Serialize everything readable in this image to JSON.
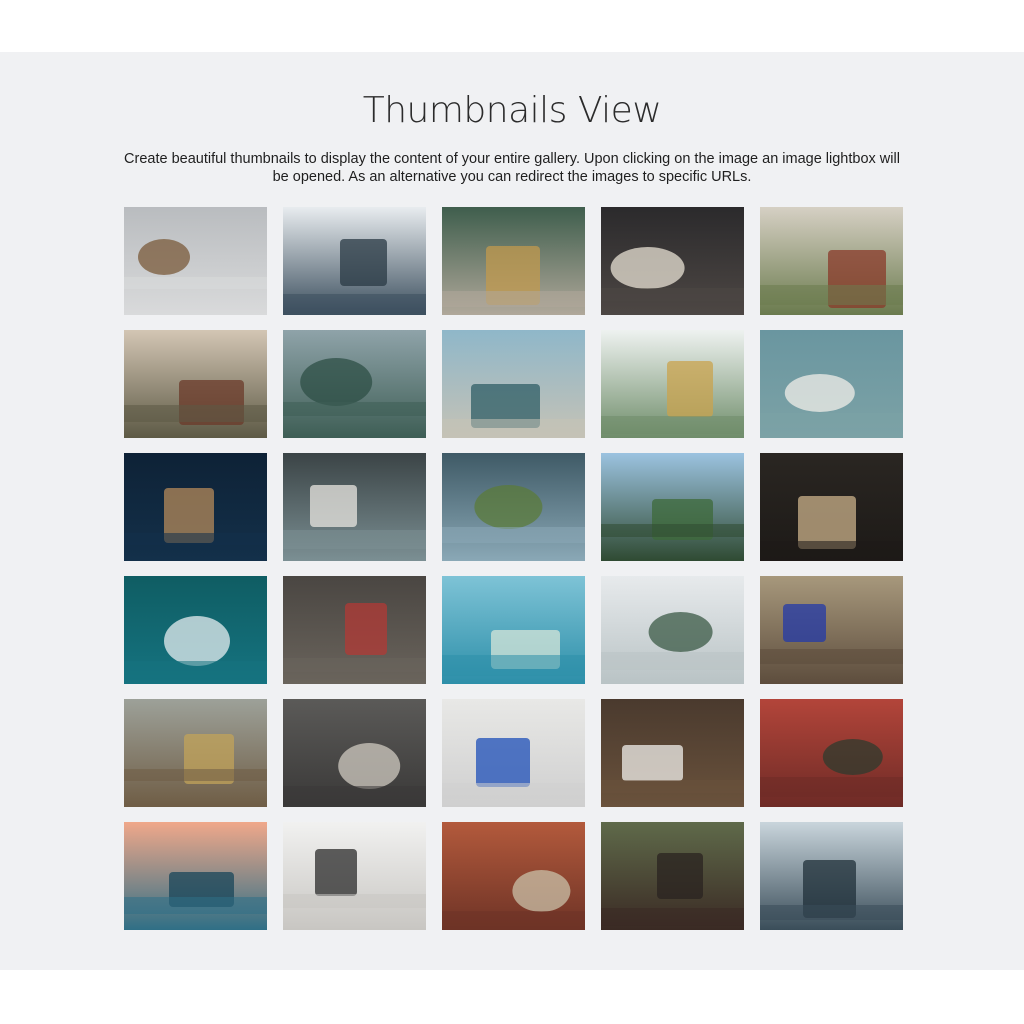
{
  "header": {
    "title": "Thumbnails View",
    "description": "Create beautiful thumbnails to display the content of your entire gallery. Upon clicking on the image an image lightbox will be opened. As an alternative you can redirect the images to specific URLs."
  },
  "gallery": {
    "thumbnails": [
      {
        "name": "thumb-mountain-biker",
        "top": "#b9bcbf",
        "bottom": "#d9dadb",
        "accent": "#7a5a3a"
      },
      {
        "name": "thumb-misty-forest",
        "top": "#e8ecef",
        "bottom": "#3c4f5e",
        "accent": "#2a3a44"
      },
      {
        "name": "thumb-bicycle-storefront",
        "top": "#3f5e4d",
        "bottom": "#b0a89a",
        "accent": "#c29a4e"
      },
      {
        "name": "thumb-clock-door",
        "top": "#2b2a2c",
        "bottom": "#4d4744",
        "accent": "#e8e1d4"
      },
      {
        "name": "thumb-coffee-crate",
        "top": "#d6d0c4",
        "bottom": "#6b7b4e",
        "accent": "#8a3a2a"
      },
      {
        "name": "thumb-house-window",
        "top": "#d3c6b4",
        "bottom": "#5d5a45",
        "accent": "#6b3a2a"
      },
      {
        "name": "thumb-coastal-cliff",
        "top": "#8fa3a9",
        "bottom": "#3e5e55",
        "accent": "#2e4f45"
      },
      {
        "name": "thumb-vintage-truck",
        "top": "#8fb7c9",
        "bottom": "#c5c2b6",
        "accent": "#2f5d66"
      },
      {
        "name": "thumb-pineapple-beach",
        "top": "#eef2f0",
        "bottom": "#6f8d6a",
        "accent": "#c9a34e"
      },
      {
        "name": "thumb-bicycle-wall",
        "top": "#6a96a0",
        "bottom": "#7ca2a6",
        "accent": "#f0eee8"
      },
      {
        "name": "thumb-boat-ocean",
        "top": "#0e2236",
        "bottom": "#13304a",
        "accent": "#b48a5a"
      },
      {
        "name": "thumb-bicycle-workshop",
        "top": "#3b4446",
        "bottom": "#7b8f93",
        "accent": "#e8e6e0"
      },
      {
        "name": "thumb-bus-interior",
        "top": "#3f5a66",
        "bottom": "#8aa8b6",
        "accent": "#5b7b3a"
      },
      {
        "name": "thumb-forest-cars",
        "top": "#9cc3e0",
        "bottom": "#2f4a32",
        "accent": "#3d6a3a"
      },
      {
        "name": "thumb-knife-axe",
        "top": "#2a2622",
        "bottom": "#1d1a17",
        "accent": "#c9b08a"
      },
      {
        "name": "thumb-boats-turquoise",
        "top": "#0f5d63",
        "bottom": "#157380",
        "accent": "#e6eef0"
      },
      {
        "name": "thumb-wooden-cabin",
        "top": "#4a4642",
        "bottom": "#6a645c",
        "accent": "#b23a36"
      },
      {
        "name": "thumb-palm-leaf",
        "top": "#7ec3d6",
        "bottom": "#2d8fa9",
        "accent": "#d6e6d8"
      },
      {
        "name": "thumb-surfer-shore",
        "top": "#e7eaec",
        "bottom": "#b9c3c5",
        "accent": "#3b5a45"
      },
      {
        "name": "thumb-blue-bicycle",
        "top": "#a7987c",
        "bottom": "#5d4d3d",
        "accent": "#2339a8"
      },
      {
        "name": "thumb-pots-shelf",
        "top": "#9da199",
        "bottom": "#6f5d45",
        "accent": "#c2a35a"
      },
      {
        "name": "thumb-chained-door",
        "top": "#5b5a58",
        "bottom": "#3a3938",
        "accent": "#cfcac0"
      },
      {
        "name": "thumb-blue-door",
        "top": "#e8e8e6",
        "bottom": "#cfcfcf",
        "accent": "#1e4fb8"
      },
      {
        "name": "thumb-coffee-cup",
        "top": "#4a3a2e",
        "bottom": "#6a523c",
        "accent": "#f0efeb"
      },
      {
        "name": "thumb-red-storefront",
        "top": "#b3453a",
        "bottom": "#6e2b26",
        "accent": "#2d3b2e"
      },
      {
        "name": "thumb-pier-sunset",
        "top": "#f0a88a",
        "bottom": "#2f6f86",
        "accent": "#18465a"
      },
      {
        "name": "thumb-big-sign",
        "top": "#f1f1f0",
        "bottom": "#c8c6c2",
        "accent": "#2b2b2b"
      },
      {
        "name": "thumb-clothing-rack",
        "top": "#b35a3c",
        "bottom": "#6e3326",
        "accent": "#c9c0a8"
      },
      {
        "name": "thumb-kettle-stove",
        "top": "#5f6a4a",
        "bottom": "#3a2a24",
        "accent": "#2a2320"
      },
      {
        "name": "thumb-foggy-pines",
        "top": "#c9d5dc",
        "bottom": "#3a4d59",
        "accent": "#20303a"
      }
    ]
  }
}
